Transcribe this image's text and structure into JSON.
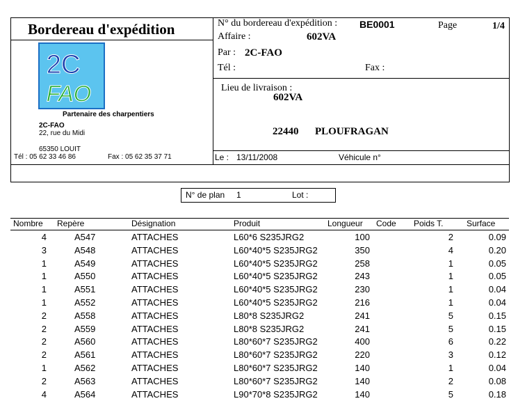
{
  "header": {
    "title": "Bordereau d'expédition",
    "bordereau_label": "N° du bordereau d'expédition :",
    "bordereau_value": "BE0001",
    "page_label": "Page",
    "page_value": "1/4",
    "affaire_label": "Affaire :",
    "affaire_value": "602VA",
    "par_label": "Par :",
    "par_value": "2C-FAO",
    "tel_label": "Tél  :",
    "fax_label": "Fax :"
  },
  "company": {
    "logo_top": "2C",
    "logo_bottom": "FAO",
    "tagline": "Partenaire des charpentiers",
    "name": "2C-FAO",
    "street": "22, rue du Midi",
    "city": "65350 LOUIT",
    "tel": "Tél  : 05 62 33 46 86",
    "fax": "Fax :  05 62 35 37 71"
  },
  "delivery": {
    "label": "Lieu de livraison :",
    "name": "602VA",
    "postcode": "22440",
    "city": "PLOUFRAGAN",
    "date_label": "Le :",
    "date_value": "13/11/2008",
    "vehicle_label": "Véhicule n°"
  },
  "plan": {
    "plan_label": "N° de plan",
    "plan_value": "1",
    "lot_label": "Lot :"
  },
  "table": {
    "columns": [
      "Nombre",
      "Repère",
      "Désignation",
      "Produit",
      "Longueur",
      "Code",
      "Poids T.",
      "Surface"
    ],
    "rows": [
      {
        "nombre": "4",
        "repere": "A547",
        "designation": "ATTACHES",
        "produit": "L60*6 S235JRG2",
        "longueur": "100",
        "code": "",
        "poids": "2",
        "surface": "0.09"
      },
      {
        "nombre": "3",
        "repere": "A548",
        "designation": "ATTACHES",
        "produit": "L60*40*5 S235JRG2",
        "longueur": "350",
        "code": "",
        "poids": "4",
        "surface": "0.20"
      },
      {
        "nombre": "1",
        "repere": "A549",
        "designation": "ATTACHES",
        "produit": "L60*40*5 S235JRG2",
        "longueur": "258",
        "code": "",
        "poids": "1",
        "surface": "0.05"
      },
      {
        "nombre": "1",
        "repere": "A550",
        "designation": "ATTACHES",
        "produit": "L60*40*5 S235JRG2",
        "longueur": "243",
        "code": "",
        "poids": "1",
        "surface": "0.05"
      },
      {
        "nombre": "1",
        "repere": "A551",
        "designation": "ATTACHES",
        "produit": "L60*40*5 S235JRG2",
        "longueur": "230",
        "code": "",
        "poids": "1",
        "surface": "0.04"
      },
      {
        "nombre": "1",
        "repere": "A552",
        "designation": "ATTACHES",
        "produit": "L60*40*5 S235JRG2",
        "longueur": "216",
        "code": "",
        "poids": "1",
        "surface": "0.04"
      },
      {
        "nombre": "2",
        "repere": "A558",
        "designation": "ATTACHES",
        "produit": "L80*8 S235JRG2",
        "longueur": "241",
        "code": "",
        "poids": "5",
        "surface": "0.15"
      },
      {
        "nombre": "2",
        "repere": "A559",
        "designation": "ATTACHES",
        "produit": "L80*8 S235JRG2",
        "longueur": "241",
        "code": "",
        "poids": "5",
        "surface": "0.15"
      },
      {
        "nombre": "2",
        "repere": "A560",
        "designation": "ATTACHES",
        "produit": "L80*60*7 S235JRG2",
        "longueur": "400",
        "code": "",
        "poids": "6",
        "surface": "0.22"
      },
      {
        "nombre": "2",
        "repere": "A561",
        "designation": "ATTACHES",
        "produit": "L80*60*7 S235JRG2",
        "longueur": "220",
        "code": "",
        "poids": "3",
        "surface": "0.12"
      },
      {
        "nombre": "1",
        "repere": "A562",
        "designation": "ATTACHES",
        "produit": "L80*60*7 S235JRG2",
        "longueur": "140",
        "code": "",
        "poids": "1",
        "surface": "0.04"
      },
      {
        "nombre": "2",
        "repere": "A563",
        "designation": "ATTACHES",
        "produit": "L80*60*7 S235JRG2",
        "longueur": "140",
        "code": "",
        "poids": "2",
        "surface": "0.08"
      },
      {
        "nombre": "4",
        "repere": "A564",
        "designation": "ATTACHES",
        "produit": "L90*70*8 S235JRG2",
        "longueur": "140",
        "code": "",
        "poids": "5",
        "surface": "0.18"
      }
    ]
  }
}
